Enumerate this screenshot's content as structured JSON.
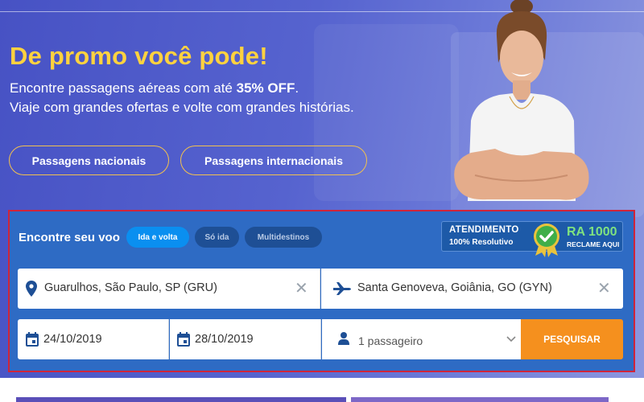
{
  "hero": {
    "headline": "De promo você pode!",
    "sub1_prefix": "Encontre passagens aéreas com até ",
    "sub1_bold": "35% OFF",
    "sub1_suffix": ".",
    "sub2": "Viaje com grandes ofertas e volte com grandes histórias.",
    "btn_nacionais": "Passagens nacionais",
    "btn_internacionais": "Passagens internacionais"
  },
  "search": {
    "title": "Encontre seu voo",
    "tabs": [
      {
        "label": "Ida e volta",
        "active": true
      },
      {
        "label": "Só ida",
        "active": false
      },
      {
        "label": "Multidestinos",
        "active": false
      }
    ],
    "origin": "Guarulhos, São Paulo, SP (GRU)",
    "destination": "Santa Genoveva, Goiânia, GO (GYN)",
    "date_out": "24/10/2019",
    "date_back": "28/10/2019",
    "passengers": "1 passageiro",
    "submit": "PESQUISAR"
  },
  "badge": {
    "line1": "ATENDIMENTO",
    "line2": "100% Resolutivo",
    "ra": "RA 1000",
    "reclame": "RECLAME AQUI"
  },
  "icons": {
    "origin": "location-pin-icon",
    "destination": "airplane-icon",
    "dates": "calendar-icon",
    "passengers": "person-icon",
    "clear": "close-icon",
    "dropdown": "chevron-down-icon",
    "seal": "check-seal-icon"
  },
  "colors": {
    "headline": "#ffd23f",
    "panel": "#2e6bc4",
    "active_tab": "#0a8ff0",
    "search_button": "#f5901e",
    "highlight_frame": "#d0243a",
    "ra_green": "#7fe27f"
  }
}
